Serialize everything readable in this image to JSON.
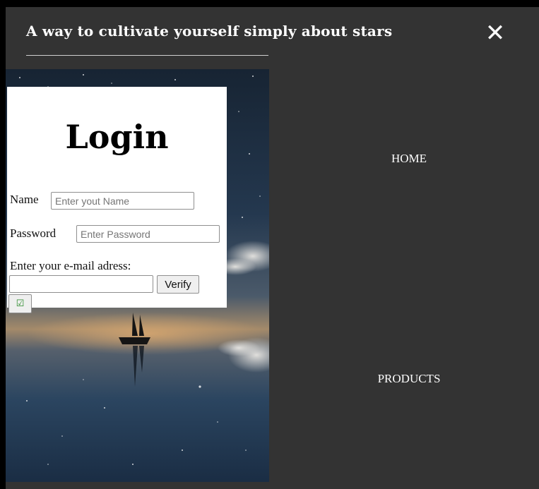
{
  "header": {
    "title": "A way to cultivate yourself simply about stars",
    "close_icon": "close-icon",
    "close_glyph": "✕"
  },
  "login": {
    "title": "Login",
    "name_label": "Name",
    "name_placeholder": "Enter yout Name",
    "password_label": "Password",
    "password_placeholder": "Enter Password",
    "email_label": "Enter your e-mail adress:",
    "email_value": "",
    "verify_label": "Verify",
    "check_glyph": "☑",
    "check_icon": "checkbox-icon"
  },
  "nav": {
    "items": [
      {
        "label": "HOME"
      },
      {
        "label": "PRODUCTS"
      }
    ]
  },
  "colors": {
    "menu_background": "#333333",
    "page_background": "#000000",
    "text_on_dark": "#ffffff"
  }
}
